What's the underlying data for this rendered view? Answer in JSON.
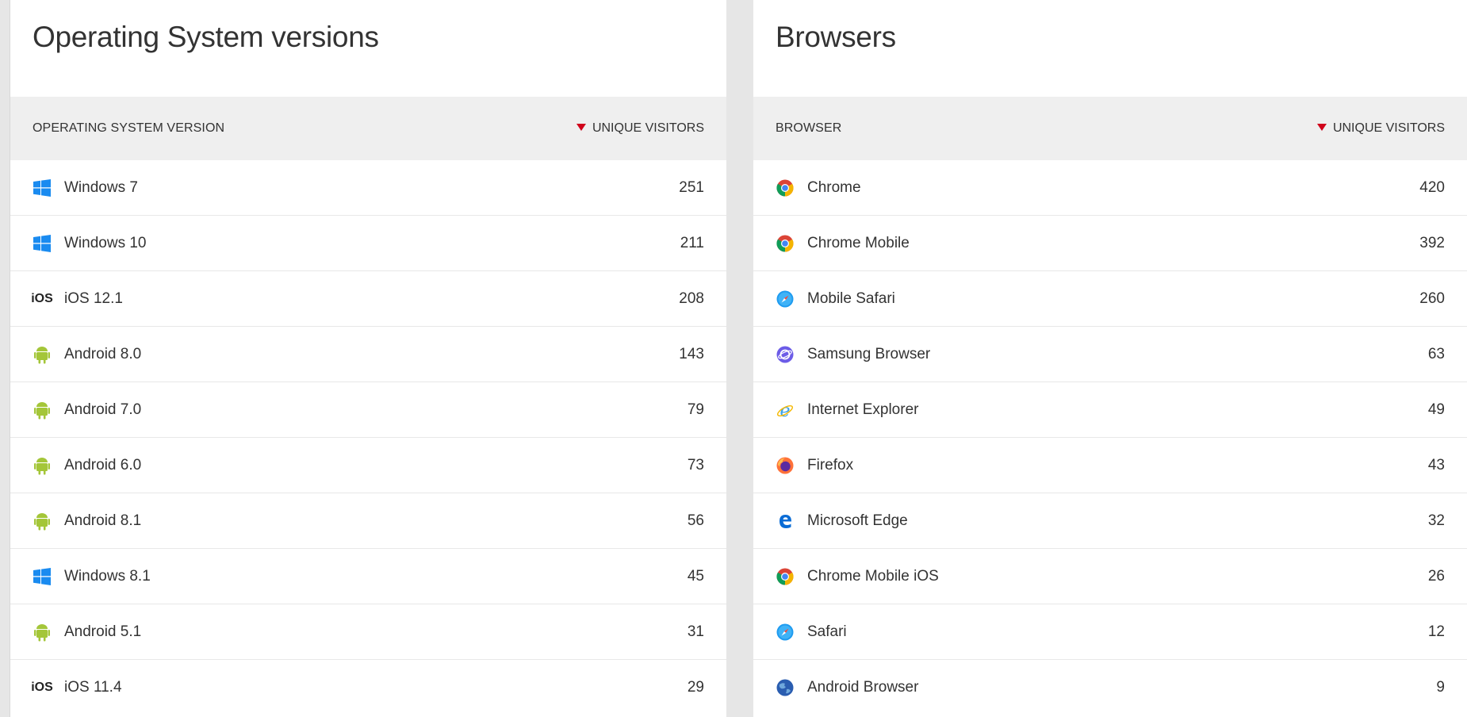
{
  "os_panel": {
    "title": "Operating System versions",
    "header": {
      "name": "OPERATING SYSTEM VERSION",
      "value": "UNIQUE VISITORS"
    },
    "rows": [
      {
        "icon": "windows-icon",
        "label": "Windows 7",
        "value": "251"
      },
      {
        "icon": "windows-icon",
        "label": "Windows 10",
        "value": "211"
      },
      {
        "icon": "ios-icon",
        "label": "iOS 12.1",
        "value": "208"
      },
      {
        "icon": "android-icon",
        "label": "Android 8.0",
        "value": "143"
      },
      {
        "icon": "android-icon",
        "label": "Android 7.0",
        "value": "79"
      },
      {
        "icon": "android-icon",
        "label": "Android 6.0",
        "value": "73"
      },
      {
        "icon": "android-icon",
        "label": "Android 8.1",
        "value": "56"
      },
      {
        "icon": "windows-icon",
        "label": "Windows 8.1",
        "value": "45"
      },
      {
        "icon": "android-icon",
        "label": "Android 5.1",
        "value": "31"
      },
      {
        "icon": "ios-icon",
        "label": "iOS 11.4",
        "value": "29"
      }
    ]
  },
  "browser_panel": {
    "title": "Browsers",
    "header": {
      "name": "BROWSER",
      "value": "UNIQUE VISITORS"
    },
    "rows": [
      {
        "icon": "chrome-icon",
        "label": "Chrome",
        "value": "420"
      },
      {
        "icon": "chrome-icon",
        "label": "Chrome Mobile",
        "value": "392"
      },
      {
        "icon": "safari-icon",
        "label": "Mobile Safari",
        "value": "260"
      },
      {
        "icon": "samsung-browser-icon",
        "label": "Samsung Browser",
        "value": "63"
      },
      {
        "icon": "internet-explorer-icon",
        "label": "Internet Explorer",
        "value": "49"
      },
      {
        "icon": "firefox-icon",
        "label": "Firefox",
        "value": "43"
      },
      {
        "icon": "edge-icon",
        "label": "Microsoft Edge",
        "value": "32"
      },
      {
        "icon": "chrome-icon",
        "label": "Chrome Mobile iOS",
        "value": "26"
      },
      {
        "icon": "safari-icon",
        "label": "Safari",
        "value": "12"
      },
      {
        "icon": "android-browser-icon",
        "label": "Android Browser",
        "value": "9"
      }
    ]
  },
  "ios_icon_text": "iOS",
  "colors": {
    "sort_arrow": "#d0021b",
    "windows": "#1a8bf0",
    "android": "#a4c639",
    "header_bg": "#efefef"
  }
}
